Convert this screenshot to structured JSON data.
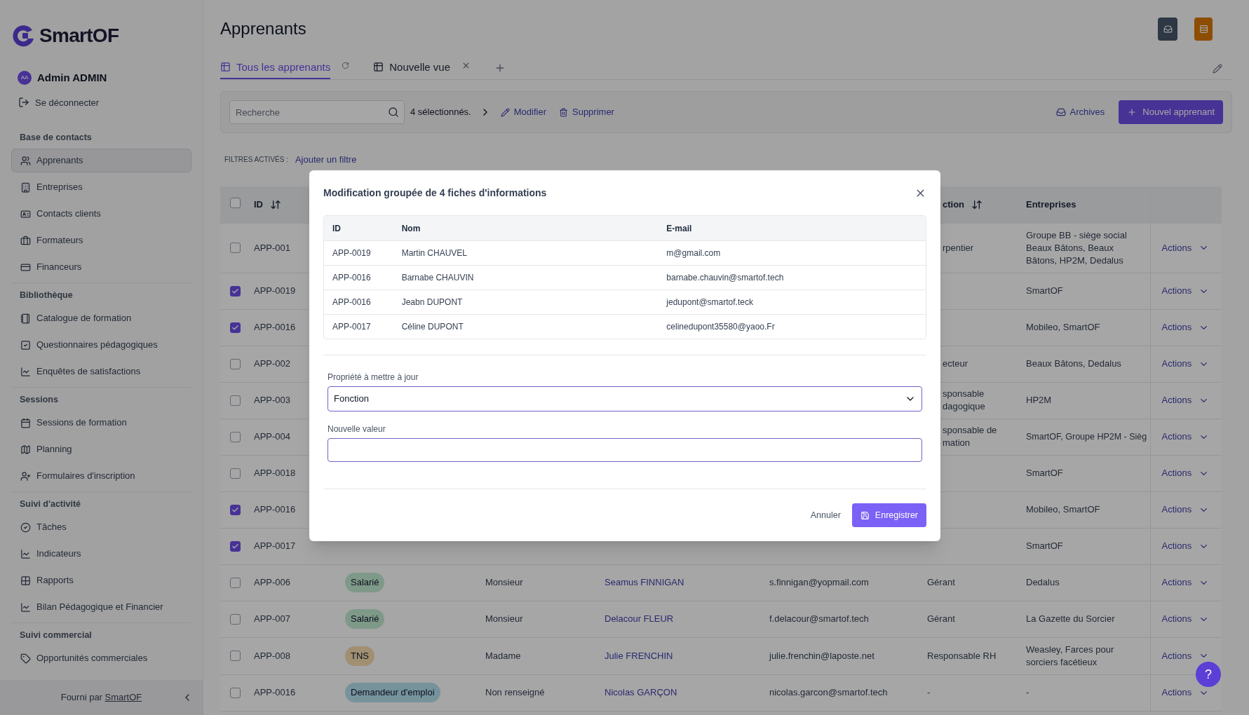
{
  "brand": {
    "name": "SmartOF"
  },
  "sidebar": {
    "user": {
      "initials": "AA",
      "name": "Admin ADMIN"
    },
    "logout": "Se déconnecter",
    "sections": [
      {
        "title": "Base de contacts",
        "items": [
          {
            "label": "Apprenants",
            "selected": true
          },
          {
            "label": "Entreprises",
            "selected": false
          },
          {
            "label": "Contacts clients",
            "selected": false
          },
          {
            "label": "Formateurs",
            "selected": false
          },
          {
            "label": "Financeurs",
            "selected": false
          }
        ]
      },
      {
        "title": "Bibliothèque",
        "items": [
          {
            "label": "Catalogue de formation",
            "selected": false
          },
          {
            "label": "Questionnaires pédagogiques",
            "selected": false
          },
          {
            "label": "Enquêtes de satisfactions",
            "selected": false
          }
        ]
      },
      {
        "title": "Sessions",
        "items": [
          {
            "label": "Sessions de formation",
            "selected": false
          },
          {
            "label": "Planning",
            "selected": false
          },
          {
            "label": "Formulaires d'inscription",
            "selected": false
          }
        ]
      },
      {
        "title": "Suivi d'activité",
        "items": [
          {
            "label": "Tâches",
            "selected": false
          },
          {
            "label": "Indicateurs",
            "selected": false
          },
          {
            "label": "Rapports",
            "selected": false
          },
          {
            "label": "Bilan Pédagogique et Financier",
            "selected": false
          }
        ]
      },
      {
        "title": "Suivi commercial",
        "items": [
          {
            "label": "Opportunités commerciales",
            "selected": false
          }
        ]
      }
    ],
    "footer": {
      "prefix": "Fourni par",
      "link": "SmartOF"
    }
  },
  "page": {
    "title": "Apprenants"
  },
  "tabs": [
    {
      "label": "Tous les apprenants",
      "selected": true,
      "refreshable": true,
      "closable": false
    },
    {
      "label": "Nouvelle vue",
      "selected": false,
      "refreshable": false,
      "closable": true
    }
  ],
  "toolbar": {
    "search": {
      "placeholder": "Recherche"
    },
    "selection": "4 sélectionnés.",
    "edit": "Modifier",
    "delete": "Supprimer",
    "archives": "Archives",
    "new": "Nouvel apprenant"
  },
  "filters": {
    "label": "FILTRES ACTIVÉS :",
    "add": "Ajouter un filtre"
  },
  "table": {
    "select_all": {
      "checked": false
    },
    "headers": {
      "id": {
        "label": "ID",
        "sortable": true
      },
      "fonction_visible_part": {
        "label": "ction",
        "sortable": true
      },
      "entreprises": {
        "label": "Entreprises"
      }
    },
    "rows": [
      {
        "id": "APP-001",
        "selected": false,
        "fonction_visible_part": [
          "rpentier"
        ],
        "entreprises": "Groupe BB - siège social Beaux Bâtons, Beaux Bâtons, HP2M, Dedalus",
        "actions": "Actions"
      },
      {
        "id": "APP-0019",
        "selected": true,
        "entreprises": "SmartOF",
        "actions": "Actions"
      },
      {
        "id": "APP-0016",
        "selected": true,
        "entreprises": "Mobileo, SmartOF",
        "actions": "Actions"
      },
      {
        "id": "APP-002",
        "selected": false,
        "fonction_visible_part": [
          "ecteur"
        ],
        "entreprises": "Beaux Bâtons, Dedalus",
        "actions": "Actions"
      },
      {
        "id": "APP-003",
        "selected": false,
        "fonction_visible_part": [
          "sponsable",
          "dagogique"
        ],
        "entreprises": "HP2M",
        "actions": "Actions"
      },
      {
        "id": "APP-004",
        "selected": false,
        "fonction_visible_part": [
          "sponsable de",
          "mation"
        ],
        "entreprises": "SmartOF, Groupe HP2M - Sièg",
        "actions": "Actions"
      },
      {
        "id": "APP-0018",
        "selected": false,
        "entreprises": "SmartOF",
        "actions": "Actions"
      },
      {
        "id": "APP-0016",
        "selected": true,
        "entreprises": "Mobileo, SmartOF",
        "actions": "Actions"
      },
      {
        "id": "APP-0017",
        "selected": true,
        "entreprises": "SmartOF",
        "actions": "Actions"
      },
      {
        "id": "APP-006",
        "selected": false,
        "type": {
          "label": "Salarié",
          "kind": "employee"
        },
        "civilite": "Monsieur",
        "name": "Seamus FINNIGAN",
        "email": "s.finnigan@yopmail.com",
        "fonction": [
          "Gérant"
        ],
        "entreprises": "Dedalus",
        "actions": "Actions"
      },
      {
        "id": "APP-007",
        "selected": false,
        "type": {
          "label": "Salarié",
          "kind": "employee"
        },
        "civilite": "Monsieur",
        "name": "Delacour FLEUR",
        "email": "f.delacour@smartof.tech",
        "fonction": [
          "Gérant"
        ],
        "entreprises": "La Gazette du Sorcier",
        "actions": "Actions"
      },
      {
        "id": "APP-008",
        "selected": false,
        "type": {
          "label": "TNS",
          "kind": "self_employed"
        },
        "civilite": "Madame",
        "name": "Julie FRENCHIN",
        "email": "julie.frenchin@laposte.net",
        "fonction": [
          "Responsable RH"
        ],
        "entreprises": "Weasley, Farces pour sorciers facétieux",
        "actions": "Actions"
      },
      {
        "id": "APP-0016",
        "selected": false,
        "type": {
          "label": "Demandeur d'emploi",
          "kind": "job_seeker"
        },
        "civilite": "Non renseigné",
        "name": "Nicolas GARÇON",
        "email": "nicolas.garcon@smartof.tech",
        "fonction": [
          "-"
        ],
        "entreprises": "-",
        "actions": "Actions"
      }
    ]
  },
  "dialog": {
    "title": "Modification groupée de 4 fiches d'informations",
    "columns": [
      "ID",
      "Nom",
      "E-mail"
    ],
    "rows": [
      [
        "APP-0019",
        "Martin CHAUVEL",
        "m@gmail.com"
      ],
      [
        "APP-0016",
        "Barnabe CHAUVIN",
        "barnabe.chauvin@smartof.tech"
      ],
      [
        "APP-0016",
        "Jeabn DUPONT",
        "jedupont@smartof.teck"
      ],
      [
        "APP-0017",
        "Céline DUPONT",
        "celinedupont35580@yaoo.Fr"
      ]
    ],
    "property": {
      "label": "Propriété à mettre à jour",
      "value": "Fonction"
    },
    "new_value": {
      "label": "Nouvelle valeur"
    },
    "cancel": "Annuler",
    "save": "Enregistrer"
  },
  "help": "?"
}
